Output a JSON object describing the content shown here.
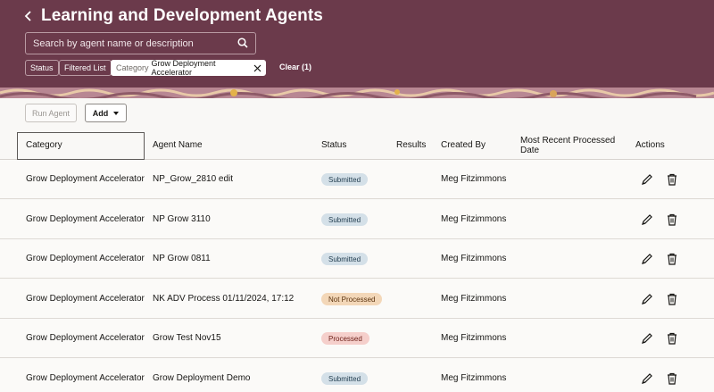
{
  "header": {
    "title": "Learning and Development Agents",
    "search_placeholder": "Search by agent name or description"
  },
  "filters": {
    "status_label": "Status",
    "filtered_list_label": "Filtered List",
    "category_chip_label": "Category",
    "category_chip_value": "Grow Deployment Accelerator",
    "clear_label": "Clear (1)"
  },
  "toolbar": {
    "run_agent_label": "Run Agent",
    "add_label": "Add"
  },
  "table": {
    "columns": {
      "category": "Category",
      "agent_name": "Agent Name",
      "status": "Status",
      "results": "Results",
      "created_by": "Created By",
      "most_recent_line1": "Most Recent Processed",
      "most_recent_line2": "Date",
      "actions": "Actions"
    },
    "rows": [
      {
        "category": "Grow Deployment Accelerator",
        "agent_name": "NP_Grow_2810 edit",
        "status": "Submitted",
        "status_kind": "submitted",
        "created_by": "Meg Fitzimmons"
      },
      {
        "category": "Grow Deployment Accelerator",
        "agent_name": "NP Grow 3110",
        "status": "Submitted",
        "status_kind": "submitted",
        "created_by": "Meg Fitzimmons"
      },
      {
        "category": "Grow Deployment Accelerator",
        "agent_name": "NP Grow 0811",
        "status": "Submitted",
        "status_kind": "submitted",
        "created_by": "Meg Fitzimmons"
      },
      {
        "category": "Grow Deployment Accelerator",
        "agent_name": "NK ADV Process 01/11/2024, 17:12",
        "status": "Not Processed",
        "status_kind": "notproc",
        "created_by": "Meg Fitzimmons"
      },
      {
        "category": "Grow Deployment Accelerator",
        "agent_name": "Grow Test Nov15",
        "status": "Processed",
        "status_kind": "processed",
        "created_by": "Meg Fitzimmons"
      },
      {
        "category": "Grow Deployment Accelerator",
        "agent_name": "Grow Deployment Demo",
        "status": "Submitted",
        "status_kind": "submitted",
        "created_by": "Meg Fitzimmons"
      }
    ]
  },
  "icons": {
    "back": "chevron-left-icon",
    "search": "search-icon",
    "clear_chip": "close-icon",
    "edit": "pencil-icon",
    "delete": "trash-icon"
  },
  "colors": {
    "header_bg": "#6b3a4b",
    "submitted_badge": "#d4e0e8",
    "not_processed_badge": "#f3d7b8",
    "processed_badge": "#f5cfcb"
  }
}
